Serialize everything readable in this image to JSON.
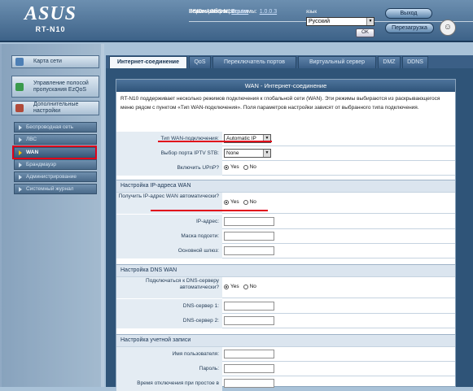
{
  "header": {
    "brand": "ASUS",
    "model": "RT-N10",
    "ssid_label": "SSID:",
    "ssid_value": "ASUS-N10",
    "fw_label": "Версия микропрограммы:",
    "fw_value": "1.0.0.3",
    "mode_label": "Режим работы:",
    "mode_value": "Router",
    "lang_label": "язык",
    "lang_value": "Русский",
    "ok_label": "OK",
    "logout_label": "Выход",
    "reboot_label": "Перезагрузка"
  },
  "sidebar": {
    "top": [
      {
        "label": "Карта сети"
      },
      {
        "label": "Управление полосой пропускания EzQoS"
      },
      {
        "label": "Дополнительные настройки"
      }
    ],
    "items": [
      {
        "label": "Беспроводная сеть"
      },
      {
        "label": "ЛВС"
      },
      {
        "label": "WAN"
      },
      {
        "label": "Брандмауэр"
      },
      {
        "label": "Администрирование"
      },
      {
        "label": "Системный журнал"
      }
    ]
  },
  "tabs": [
    {
      "label": "Интернет-соединение"
    },
    {
      "label": "QoS"
    },
    {
      "label": "Переключатель портов"
    },
    {
      "label": "Виртуальный сервер"
    },
    {
      "label": "DMZ"
    },
    {
      "label": "DDNS"
    }
  ],
  "panel": {
    "title": "WAN - Интернет-соединение",
    "desc": "RT-N10 поддерживает несколько режимов подключения к глобальной сети (WAN). Эти режимы выбираются из раскрывающегося меню рядом с пунктом «Тип WAN-подключения». Поля параметров настройки зависят от выбранного типа подключения.",
    "conn_type_label": "Тип WAN-подключения:",
    "conn_type_value": "Automatic IP",
    "iptv_label": "Выбор порта IPTV STB:",
    "iptv_value": "None",
    "upnp_label": "Включить UPnP?",
    "yes": "Yes",
    "no": "No",
    "ip_section": "Настройка IP-адреса WAN",
    "auto_ip_label": "Получить IP-адрес WAN автоматически?",
    "ip_label": "IP-адрес:",
    "mask_label": "Маска подсети:",
    "gw_label": "Основной шлюз:",
    "dns_section": "Настройка DNS WAN",
    "dns_auto_label": "Подключаться к DNS-серверу автоматически?",
    "dns1_label": "DNS-сервер 1:",
    "dns2_label": "DNS-сервер 2:",
    "acct_section": "Настройка учетной записи",
    "user_label": "Имя пользователя:",
    "pass_label": "Пароль:",
    "idle_label": "Время отключения при простое в"
  },
  "colors": {
    "highlight": "#e0001a",
    "header": "#3d6288",
    "title_bar": "#2f5479"
  }
}
